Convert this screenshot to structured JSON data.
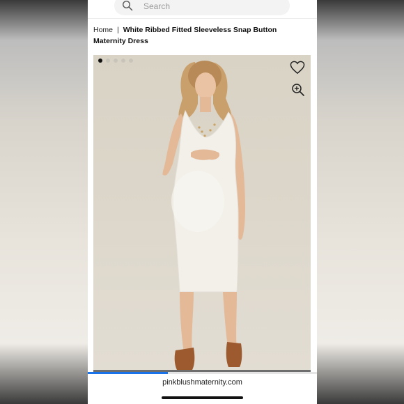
{
  "search": {
    "placeholder": "Search",
    "icon": "search-icon"
  },
  "breadcrumb": {
    "home": "Home",
    "separator": "|",
    "title": "White Ribbed Fitted Sleeveless Snap Button Maternity Dress"
  },
  "gallery": {
    "total_images": 5,
    "active_index": 0,
    "actions": [
      "heart-icon",
      "zoom-in-icon"
    ]
  },
  "page_scroll_progress": 0.35,
  "browser": {
    "url": "pinkblushmaternity.com"
  },
  "colors": {
    "accent": "#1a73e8",
    "text": "#111111",
    "dress": "#f3f0ea",
    "background": "#ffffff"
  }
}
